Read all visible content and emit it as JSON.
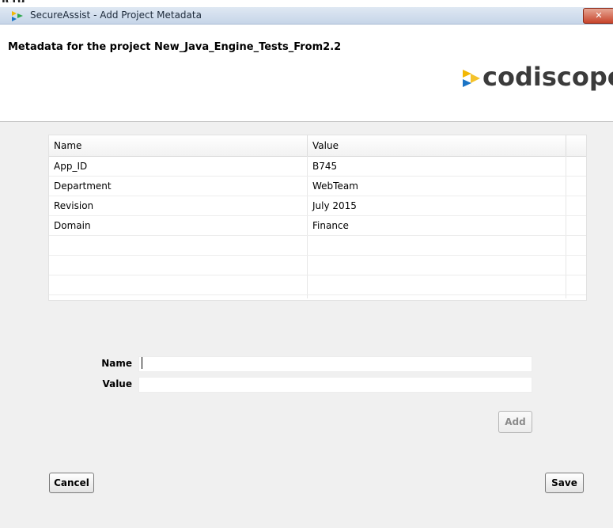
{
  "top_fragment": "ictu",
  "window": {
    "title": "SecureAssist - Add Project Metadata",
    "close_label": "✕"
  },
  "header": {
    "title": "Metadata for the project New_Java_Engine_Tests_From2.2",
    "logo_text": "codiscope"
  },
  "table": {
    "columns": [
      "Name",
      "Value"
    ],
    "rows": [
      {
        "name": "App_ID",
        "value": "B745"
      },
      {
        "name": "Department",
        "value": "WebTeam"
      },
      {
        "name": "Revision",
        "value": "July 2015"
      },
      {
        "name": "Domain",
        "value": "Finance"
      }
    ]
  },
  "form": {
    "name_label": "Name",
    "value_label": "Value",
    "name_value": "",
    "value_value": "",
    "add_label": "Add"
  },
  "footer": {
    "cancel_label": "Cancel",
    "save_label": "Save"
  },
  "colors": {
    "logo_arrow_yellow": "#f2b705",
    "logo_arrow_blue": "#1b74c5"
  }
}
